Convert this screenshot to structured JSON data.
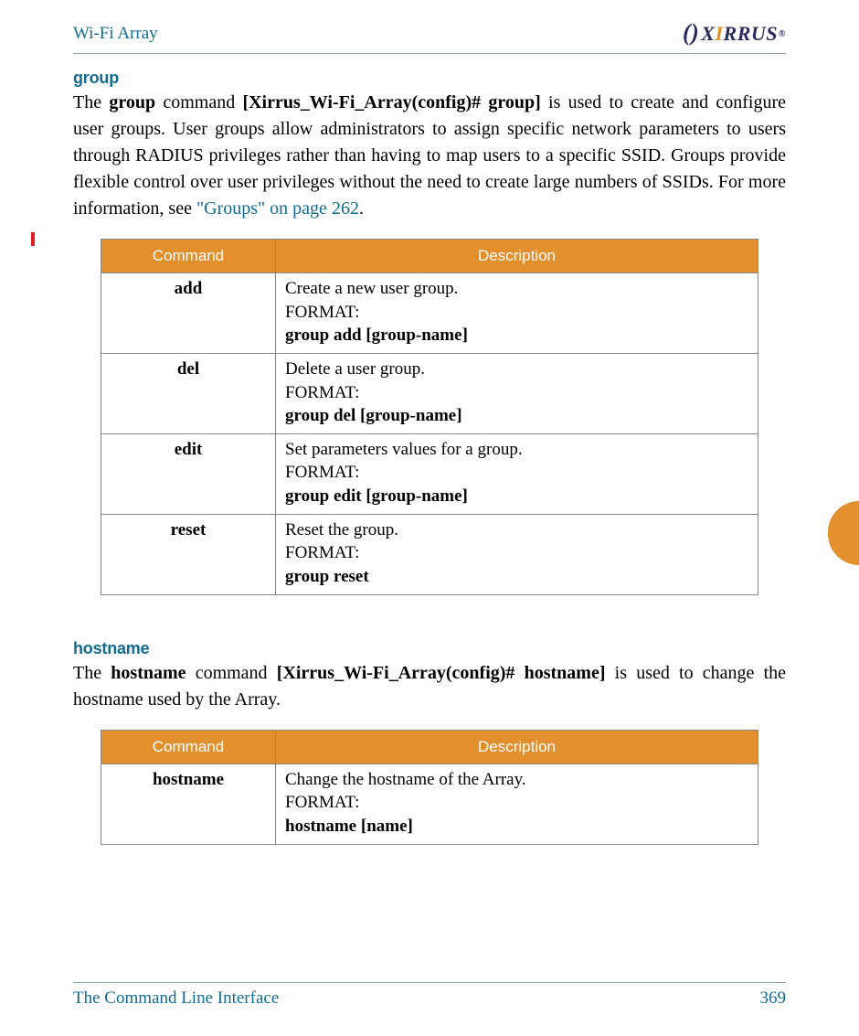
{
  "header": {
    "title": "Wi-Fi Array",
    "brand": "XIRRUS"
  },
  "footer": {
    "section": "The Command Line Interface",
    "page": "369"
  },
  "sections": {
    "group": {
      "heading": "group",
      "p_pre": "The ",
      "p_cmd": "group",
      "p_mid1": " command ",
      "p_prompt": "[Xirrus_Wi-Fi_Array(config)# group]",
      "p_post1": " is used to create and configure user groups. User groups allow administrators to assign specific network parameters to users through RADIUS privileges rather than having to map users to a specific SSID. Groups provide flexible control over user privileges without the need to create large numbers of SSIDs. For more information, see ",
      "link": "\"Groups\" on page 262",
      "p_end": "."
    },
    "hostname": {
      "heading": "hostname",
      "p_pre": "The ",
      "p_cmd": "hostname",
      "p_mid1": " command ",
      "p_prompt": "[Xirrus_Wi-Fi_Array(config)# hostname]",
      "p_post1": " is used to change the hostname used by the Array."
    }
  },
  "tables": {
    "headers": {
      "c1": "Command",
      "c2": "Description"
    },
    "group": [
      {
        "cmd": "add",
        "l1": "Create a new user group.",
        "l2": "FORMAT:",
        "l3": "group add [group-name]"
      },
      {
        "cmd": "del",
        "l1": "Delete a user group.",
        "l2": "FORMAT:",
        "l3": "group del [group-name]"
      },
      {
        "cmd": "edit",
        "l1": "Set parameters values for a group.",
        "l2": "FORMAT:",
        "l3": "group edit [group-name]"
      },
      {
        "cmd": "reset",
        "l1": "Reset the group.",
        "l2": "FORMAT:",
        "l3": "group reset"
      }
    ],
    "hostname": [
      {
        "cmd": "hostname",
        "l1": "Change the hostname of the Array.",
        "l2": "FORMAT:",
        "l3": "hostname [name]"
      }
    ]
  }
}
